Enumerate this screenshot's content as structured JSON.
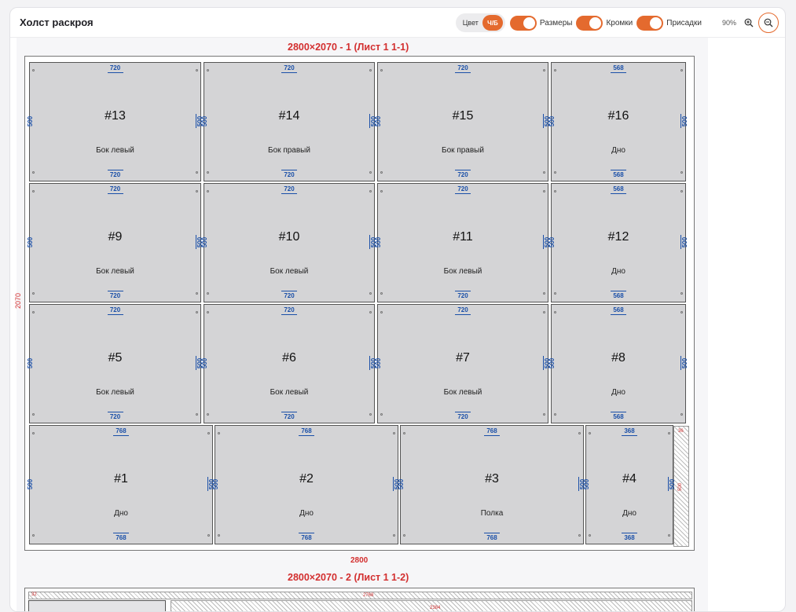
{
  "header": {
    "title": "Холст раскроя",
    "color_label": "Цвет",
    "bw_label": "Ч/Б",
    "toggles": [
      "Размеры",
      "Кромки",
      "Присадки"
    ],
    "zoom": "90%"
  },
  "sheet1": {
    "title": "2800×2070 - 1 (Лист 1 1-1)",
    "width": "2800",
    "height": "2070",
    "offcut_w": "36",
    "offcut_h": "500",
    "parts": [
      {
        "num": "#13",
        "name": "Бок левый",
        "w": "720",
        "h": "500"
      },
      {
        "num": "#14",
        "name": "Бок правый",
        "w": "720",
        "h": "500"
      },
      {
        "num": "#15",
        "name": "Бок правый",
        "w": "720",
        "h": "500"
      },
      {
        "num": "#16",
        "name": "Дно",
        "w": "568",
        "h": "500"
      },
      {
        "num": "#9",
        "name": "Бок левый",
        "w": "720",
        "h": "500"
      },
      {
        "num": "#10",
        "name": "Бок левый",
        "w": "720",
        "h": "500"
      },
      {
        "num": "#11",
        "name": "Бок левый",
        "w": "720",
        "h": "500"
      },
      {
        "num": "#12",
        "name": "Дно",
        "w": "568",
        "h": "500"
      },
      {
        "num": "#5",
        "name": "Бок левый",
        "w": "720",
        "h": "500"
      },
      {
        "num": "#6",
        "name": "Бок левый",
        "w": "720",
        "h": "500"
      },
      {
        "num": "#7",
        "name": "Бок левый",
        "w": "720",
        "h": "500"
      },
      {
        "num": "#8",
        "name": "Дно",
        "w": "568",
        "h": "500"
      },
      {
        "num": "#1",
        "name": "Дно",
        "w": "768",
        "h": "500"
      },
      {
        "num": "#2",
        "name": "Дно",
        "w": "768",
        "h": "500"
      },
      {
        "num": "#3",
        "name": "Полка",
        "w": "768",
        "h": "500"
      },
      {
        "num": "#4",
        "name": "Дно",
        "w": "368",
        "h": "500"
      }
    ]
  },
  "sheet2": {
    "title": "2800×2070 - 2 (Лист 1 1-2)",
    "top_dim": "2768",
    "inner_dim": "2384",
    "left_dim": "32"
  }
}
